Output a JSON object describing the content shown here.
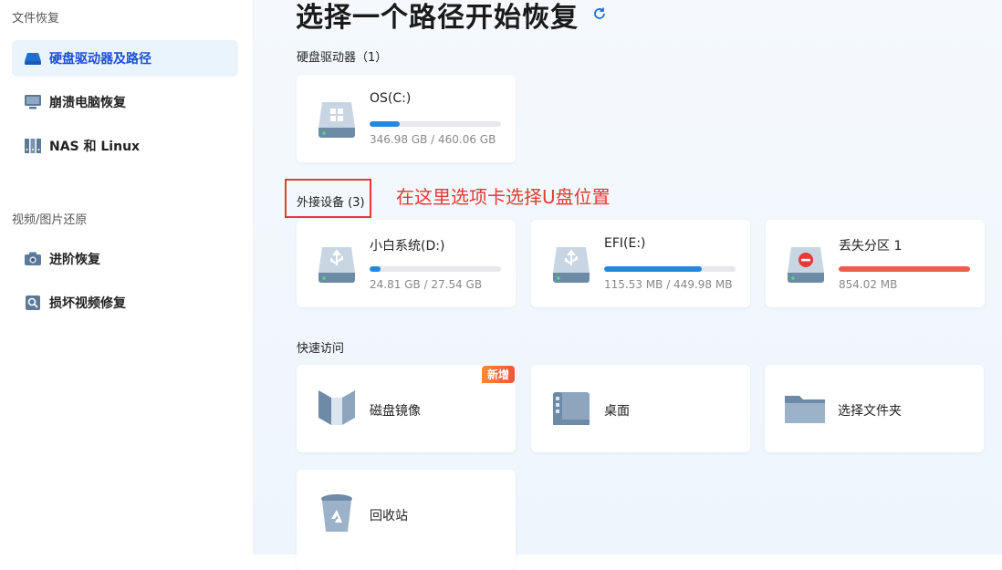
{
  "sidebar": {
    "section1_title": "文件恢复",
    "section2_title": "视频/图片还原",
    "items": [
      {
        "label": "硬盘驱动器及路径"
      },
      {
        "label": "崩溃电脑恢复"
      },
      {
        "label": "NAS 和 Linux"
      },
      {
        "label": "进阶恢复"
      },
      {
        "label": "损坏视频修复"
      }
    ]
  },
  "main": {
    "title": "选择一个路径开始恢复",
    "hard_drives": {
      "title": "硬盘驱动器（1）",
      "drives": [
        {
          "name": "OS(C:)",
          "size": "346.98 GB / 460.06 GB",
          "used_fraction": 0.23,
          "color": "#2388e0"
        }
      ]
    },
    "external": {
      "title": "外接设备 (3)",
      "drives": [
        {
          "name": "小白系统(D:)",
          "size": "24.81 GB / 27.54 GB",
          "used_fraction": 0.08,
          "color": "#2388e0"
        },
        {
          "name": "EFI(E:)",
          "size": "115.53 MB / 449.98 MB",
          "used_fraction": 0.74,
          "color": "#2388e0"
        },
        {
          "name": "丢失分区 1",
          "size": "854.02 MB",
          "used_fraction": 1.0,
          "color": "#f05a4f"
        }
      ]
    },
    "quick_access": {
      "title": "快速访问",
      "items": [
        {
          "label": "磁盘镜像",
          "badge": "新增"
        },
        {
          "label": "桌面"
        },
        {
          "label": "选择文件夹"
        },
        {
          "label": "回收站"
        }
      ]
    },
    "annotation": "在这里选项卡选择U盘位置"
  }
}
